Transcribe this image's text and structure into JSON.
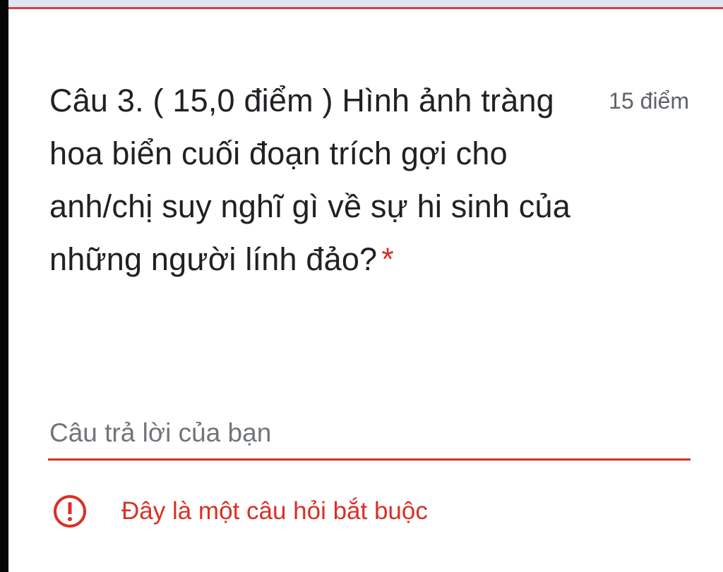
{
  "question": {
    "title": "Câu 3. ( 15,0 điểm ) Hình ảnh tràng hoa biển cuối đoạn trích gợi cho anh/chị suy nghĩ gì về sự hi sinh của những người lính đảo?",
    "required_marker": "*",
    "points": "15 điểm"
  },
  "answer": {
    "placeholder": "Câu trả lời của bạn",
    "value": ""
  },
  "validation": {
    "icon": "error-circle-icon",
    "message": "Đây là một câu hỏi bắt buộc"
  },
  "colors": {
    "accent_error": "#d93025",
    "text_primary": "#202124",
    "text_secondary": "#5f6368"
  }
}
